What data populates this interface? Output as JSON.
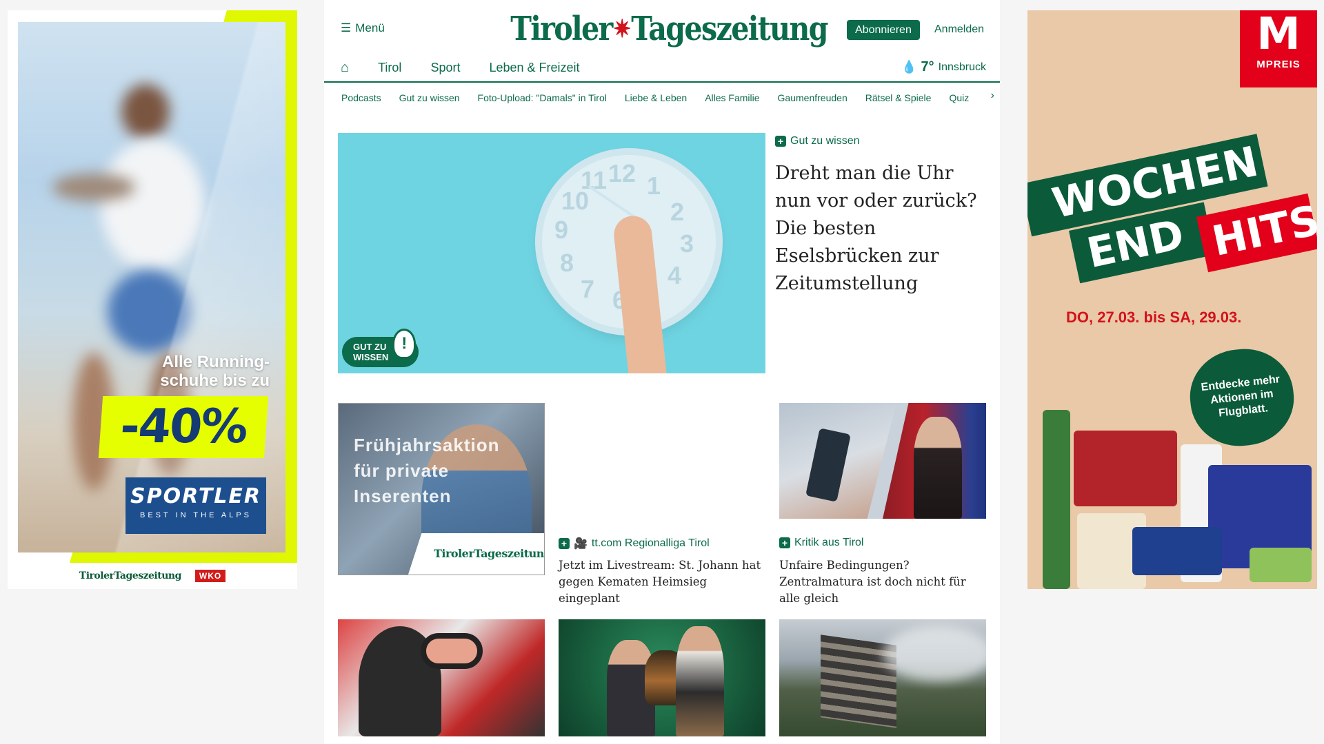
{
  "left_ad": {
    "headline_line1": "Alle Running-",
    "headline_line2": "schuhe bis zu",
    "discount": "-40%",
    "brand": "SPORTLER",
    "brand_tagline": "BEST IN THE ALPS",
    "footer_logo": "TirolerTageszeitung",
    "footer_wko": "WKO"
  },
  "right_ad": {
    "logo_letter": "M",
    "logo_word": "MPREIS",
    "banner_line1": "WOCHEN",
    "banner_line2a": "END",
    "banner_line2b": "HITS",
    "dates": "DO, 27.03. bis SA, 29.03.",
    "badge": "Entdecke mehr Aktionen im Flugblatt."
  },
  "header": {
    "menu_label": "Menü",
    "logo_left": "Tiroler",
    "logo_right": "Tageszeitung",
    "subscribe_label": "Abonnieren",
    "login_label": "Anmelden"
  },
  "nav": {
    "items": [
      "Tirol",
      "Sport",
      "Leben & Freizeit"
    ]
  },
  "weather": {
    "temp": "7°",
    "city": "Innsbruck"
  },
  "subnav": {
    "items": [
      "Podcasts",
      "Gut zu wissen",
      "Foto-Upload: \"Damals\" in Tirol",
      "Liebe & Leben",
      "Alles Familie",
      "Gaumenfreuden",
      "Rätsel & Spiele",
      "Quiz"
    ]
  },
  "hero": {
    "badge_line1": "GUT ZU",
    "badge_line2": "WISSEN",
    "kicker": "Gut zu wissen",
    "title": "Dreht man die Uhr nun vor oder zurück? Die besten Eselsbrücken zur Zeitumstellung",
    "clock_numbers": [
      "11",
      "12",
      "1",
      "2",
      "3",
      "4",
      "6",
      "7",
      "8",
      "9",
      "10"
    ]
  },
  "cards": {
    "promo_line1": "Frühjahrsaktion",
    "promo_line2": "für private",
    "promo_line3": "Inserenten",
    "promo_logo": "TirolerTageszeitung",
    "live_kicker": "tt.com Regionalliga Tirol",
    "live_title": "Jetzt im Livestream: St. Johann hat gegen Kematen Heimsieg eingeplant",
    "matura_kicker": "Kritik aus Tirol",
    "matura_title": "Unfaire Bedingungen? Zentralmatura ist doch nicht für alle gleich"
  }
}
